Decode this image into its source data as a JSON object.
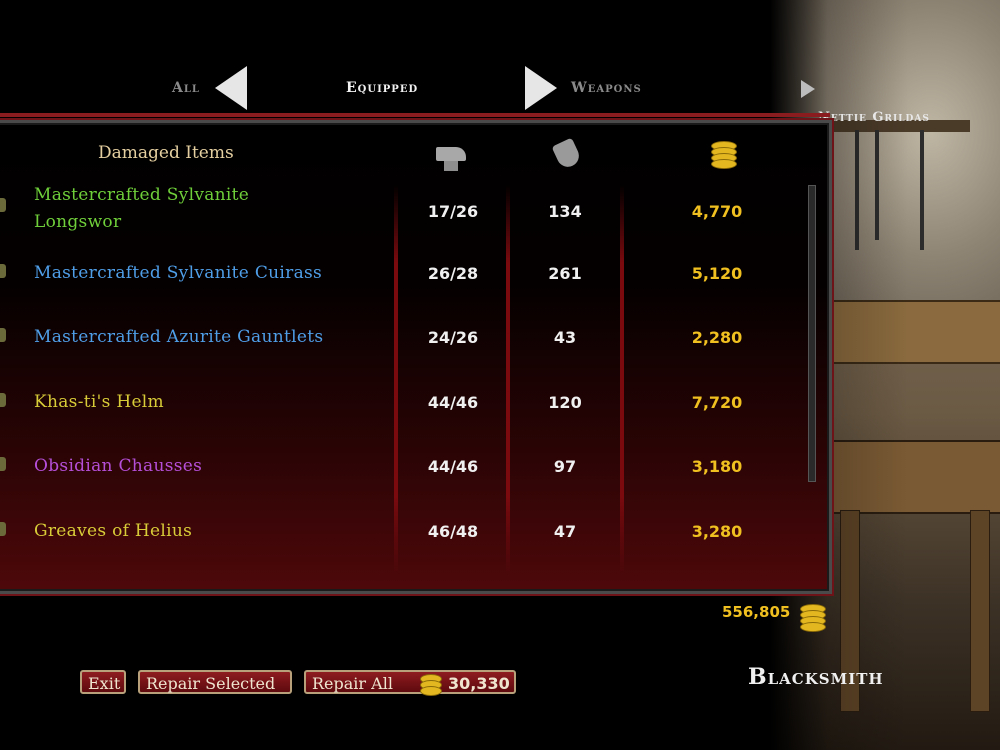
{
  "nav": {
    "left_tab": "All",
    "current_tab": "Equipped",
    "right_tab": "Weapons",
    "merchant_name": "Nettie Grildas"
  },
  "table": {
    "header_title": "Damaged Items",
    "header_icons": [
      "anvil-icon",
      "armor-icon",
      "gold-coins-icon"
    ],
    "rows": [
      {
        "name": "Mastercrafted Sylvanite Longswor",
        "durability": "17/26",
        "armor": "134",
        "cost": "4,770",
        "color": "#6fcf3a"
      },
      {
        "name": "Mastercrafted Sylvanite Cuirass",
        "durability": "26/28",
        "armor": "261",
        "cost": "5,120",
        "color": "#4f9ee8"
      },
      {
        "name": "Mastercrafted Azurite Gauntlets",
        "durability": "24/26",
        "armor": "43",
        "cost": "2,280",
        "color": "#4f9ee8"
      },
      {
        "name": "Khas-ti's Helm",
        "durability": "44/46",
        "armor": "120",
        "cost": "7,720",
        "color": "#d8cc38"
      },
      {
        "name": "Obsidian Chausses",
        "durability": "44/46",
        "armor": "97",
        "cost": "3,180",
        "color": "#b54fd8"
      },
      {
        "name": "Greaves of Helius",
        "durability": "46/48",
        "armor": "47",
        "cost": "3,280",
        "color": "#d8cc38"
      }
    ]
  },
  "gold": {
    "total": "556,805"
  },
  "buttons": {
    "exit": "Exit",
    "repair_selected": "Repair Selected",
    "repair_all": "Repair All",
    "repair_all_cost": "30,330"
  },
  "vendor_type": "Blacksmith",
  "colors": {
    "accent_red": "#8a1c20",
    "gold": "#f0c020"
  }
}
